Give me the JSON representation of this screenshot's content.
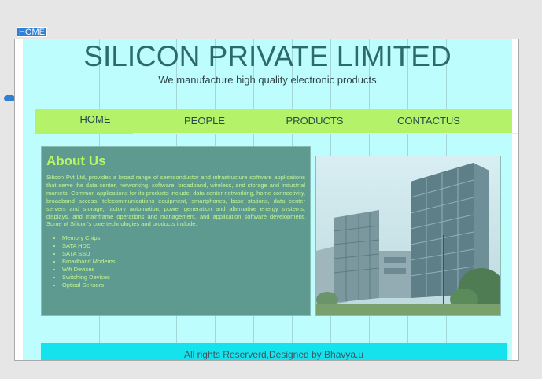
{
  "editor": {
    "selected_tag": "HOME"
  },
  "header": {
    "title": "SILICON PRIVATE LIMITED",
    "subtitle": "We manufacture high quality electronic products"
  },
  "nav": {
    "items": [
      {
        "label": "HOME"
      },
      {
        "label": "PEOPLE"
      },
      {
        "label": "PRODUCTS"
      },
      {
        "label": "CONTACTUS"
      }
    ]
  },
  "about": {
    "heading": "About Us",
    "body": "Silicon Pvt Ltd, provides a broad range of semiconductor and infrastructure software applications that serve the data center, networking, software, broadband, wireless, and storage and industrial markets. Common applications for its products include: data center networking, home connectivity, broadband access, telecommunications equipment, smartphones, base stations, data center servers and storage, factory automation, power generation and alternative energy systems, displays, and mainframe operations and management, and application software development. Some of Silicon's core technologies and products include:",
    "products": [
      "Memory Chips",
      "SATA HDD",
      "SATA SSD",
      "Broadband Modems",
      "Wifi Devices",
      "Switching Devices",
      "Optical Sensors"
    ]
  },
  "footer": {
    "text": "All rights Reserverd,Designed by Bhavya.u"
  },
  "colors": {
    "page_bg": "#bdfdfd",
    "title": "#2b6c6a",
    "nav_bg": "#b4f369",
    "about_bg": "#5f9a91",
    "about_heading": "#b7f862",
    "footer_bg": "#14e3ee",
    "selection": "#2f7fd6"
  }
}
